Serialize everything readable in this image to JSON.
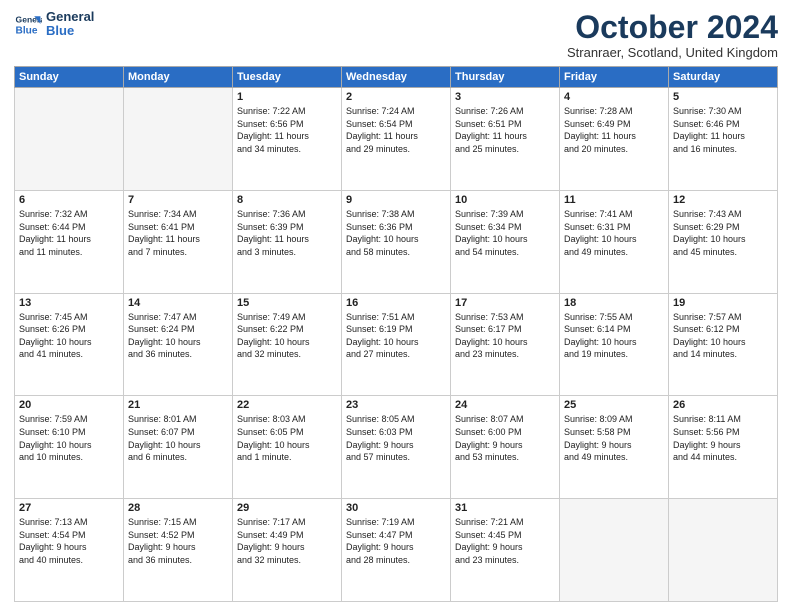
{
  "logo": {
    "line1": "General",
    "line2": "Blue"
  },
  "title": "October 2024",
  "subtitle": "Stranraer, Scotland, United Kingdom",
  "days_of_week": [
    "Sunday",
    "Monday",
    "Tuesday",
    "Wednesday",
    "Thursday",
    "Friday",
    "Saturday"
  ],
  "weeks": [
    [
      {
        "day": "",
        "info": ""
      },
      {
        "day": "",
        "info": ""
      },
      {
        "day": "1",
        "info": "Sunrise: 7:22 AM\nSunset: 6:56 PM\nDaylight: 11 hours\nand 34 minutes."
      },
      {
        "day": "2",
        "info": "Sunrise: 7:24 AM\nSunset: 6:54 PM\nDaylight: 11 hours\nand 29 minutes."
      },
      {
        "day": "3",
        "info": "Sunrise: 7:26 AM\nSunset: 6:51 PM\nDaylight: 11 hours\nand 25 minutes."
      },
      {
        "day": "4",
        "info": "Sunrise: 7:28 AM\nSunset: 6:49 PM\nDaylight: 11 hours\nand 20 minutes."
      },
      {
        "day": "5",
        "info": "Sunrise: 7:30 AM\nSunset: 6:46 PM\nDaylight: 11 hours\nand 16 minutes."
      }
    ],
    [
      {
        "day": "6",
        "info": "Sunrise: 7:32 AM\nSunset: 6:44 PM\nDaylight: 11 hours\nand 11 minutes."
      },
      {
        "day": "7",
        "info": "Sunrise: 7:34 AM\nSunset: 6:41 PM\nDaylight: 11 hours\nand 7 minutes."
      },
      {
        "day": "8",
        "info": "Sunrise: 7:36 AM\nSunset: 6:39 PM\nDaylight: 11 hours\nand 3 minutes."
      },
      {
        "day": "9",
        "info": "Sunrise: 7:38 AM\nSunset: 6:36 PM\nDaylight: 10 hours\nand 58 minutes."
      },
      {
        "day": "10",
        "info": "Sunrise: 7:39 AM\nSunset: 6:34 PM\nDaylight: 10 hours\nand 54 minutes."
      },
      {
        "day": "11",
        "info": "Sunrise: 7:41 AM\nSunset: 6:31 PM\nDaylight: 10 hours\nand 49 minutes."
      },
      {
        "day": "12",
        "info": "Sunrise: 7:43 AM\nSunset: 6:29 PM\nDaylight: 10 hours\nand 45 minutes."
      }
    ],
    [
      {
        "day": "13",
        "info": "Sunrise: 7:45 AM\nSunset: 6:26 PM\nDaylight: 10 hours\nand 41 minutes."
      },
      {
        "day": "14",
        "info": "Sunrise: 7:47 AM\nSunset: 6:24 PM\nDaylight: 10 hours\nand 36 minutes."
      },
      {
        "day": "15",
        "info": "Sunrise: 7:49 AM\nSunset: 6:22 PM\nDaylight: 10 hours\nand 32 minutes."
      },
      {
        "day": "16",
        "info": "Sunrise: 7:51 AM\nSunset: 6:19 PM\nDaylight: 10 hours\nand 27 minutes."
      },
      {
        "day": "17",
        "info": "Sunrise: 7:53 AM\nSunset: 6:17 PM\nDaylight: 10 hours\nand 23 minutes."
      },
      {
        "day": "18",
        "info": "Sunrise: 7:55 AM\nSunset: 6:14 PM\nDaylight: 10 hours\nand 19 minutes."
      },
      {
        "day": "19",
        "info": "Sunrise: 7:57 AM\nSunset: 6:12 PM\nDaylight: 10 hours\nand 14 minutes."
      }
    ],
    [
      {
        "day": "20",
        "info": "Sunrise: 7:59 AM\nSunset: 6:10 PM\nDaylight: 10 hours\nand 10 minutes."
      },
      {
        "day": "21",
        "info": "Sunrise: 8:01 AM\nSunset: 6:07 PM\nDaylight: 10 hours\nand 6 minutes."
      },
      {
        "day": "22",
        "info": "Sunrise: 8:03 AM\nSunset: 6:05 PM\nDaylight: 10 hours\nand 1 minute."
      },
      {
        "day": "23",
        "info": "Sunrise: 8:05 AM\nSunset: 6:03 PM\nDaylight: 9 hours\nand 57 minutes."
      },
      {
        "day": "24",
        "info": "Sunrise: 8:07 AM\nSunset: 6:00 PM\nDaylight: 9 hours\nand 53 minutes."
      },
      {
        "day": "25",
        "info": "Sunrise: 8:09 AM\nSunset: 5:58 PM\nDaylight: 9 hours\nand 49 minutes."
      },
      {
        "day": "26",
        "info": "Sunrise: 8:11 AM\nSunset: 5:56 PM\nDaylight: 9 hours\nand 44 minutes."
      }
    ],
    [
      {
        "day": "27",
        "info": "Sunrise: 7:13 AM\nSunset: 4:54 PM\nDaylight: 9 hours\nand 40 minutes."
      },
      {
        "day": "28",
        "info": "Sunrise: 7:15 AM\nSunset: 4:52 PM\nDaylight: 9 hours\nand 36 minutes."
      },
      {
        "day": "29",
        "info": "Sunrise: 7:17 AM\nSunset: 4:49 PM\nDaylight: 9 hours\nand 32 minutes."
      },
      {
        "day": "30",
        "info": "Sunrise: 7:19 AM\nSunset: 4:47 PM\nDaylight: 9 hours\nand 28 minutes."
      },
      {
        "day": "31",
        "info": "Sunrise: 7:21 AM\nSunset: 4:45 PM\nDaylight: 9 hours\nand 23 minutes."
      },
      {
        "day": "",
        "info": ""
      },
      {
        "day": "",
        "info": ""
      }
    ]
  ]
}
